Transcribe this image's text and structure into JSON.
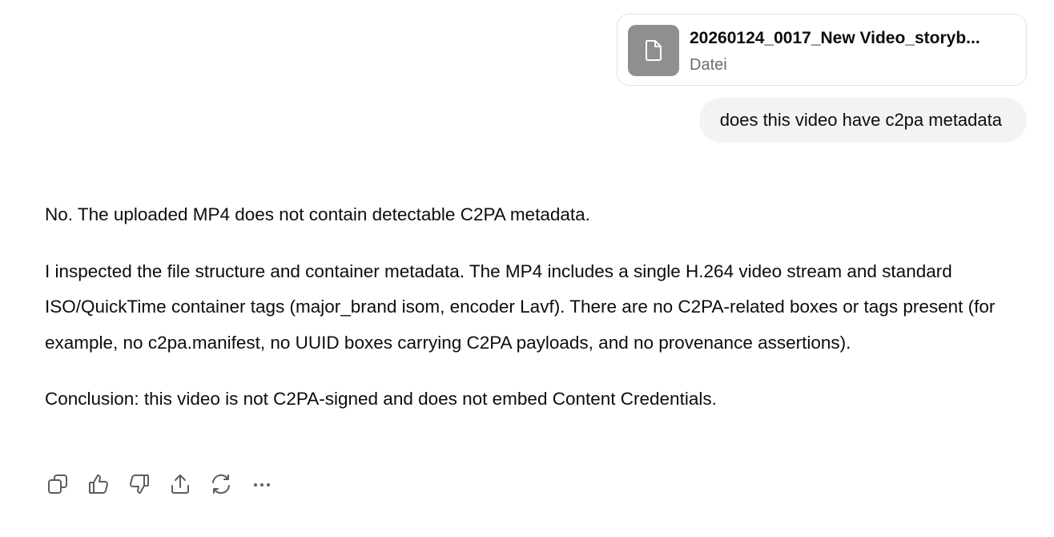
{
  "attachment": {
    "file_name": "20260124_0017_New Video_storyb...",
    "file_type": "Datei",
    "icon": "document-icon"
  },
  "user_message": {
    "text": "does this video have c2pa metadata"
  },
  "assistant_message": {
    "paragraphs": [
      "No. The uploaded MP4 does not contain detectable C2PA metadata.",
      "I inspected the file structure and container metadata. The MP4 includes a single H.264 video stream and standard ISO/QuickTime container tags (major_brand isom, encoder Lavf). There are no C2PA-related boxes or tags present (for example, no c2pa.manifest, no UUID boxes carrying C2PA payloads, and no provenance assertions).",
      "Conclusion: this video is not C2PA-signed and does not embed Content Credentials."
    ]
  },
  "action_bar": {
    "icons": [
      "copy-icon",
      "thumbs-up-icon",
      "thumbs-down-icon",
      "share-icon",
      "regenerate-icon",
      "more-icon"
    ]
  },
  "colors": {
    "bubble_background": "#f3f3f3",
    "file_icon_background": "#8f8f8f",
    "secondary_text": "#6b6b6b",
    "icon_color": "#5d5d5d"
  }
}
